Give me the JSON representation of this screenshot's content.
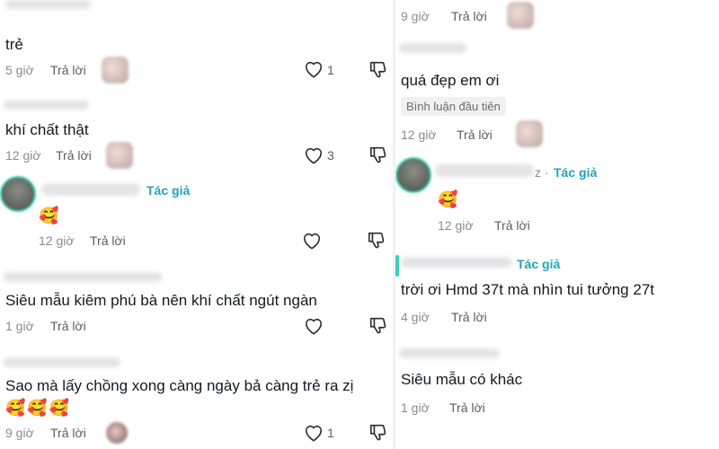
{
  "left": {
    "c1": {
      "text": "trẻ",
      "time": "5 giờ",
      "reply": "Trả lời",
      "likes": "1"
    },
    "c2": {
      "text": "khí chất thật",
      "time": "12 giờ",
      "reply": "Trả lời",
      "likes": "3"
    },
    "c3": {
      "author_tag": "Tác giả",
      "emoji": "🥰",
      "time": "12 giờ",
      "reply": "Trả lời"
    },
    "c4": {
      "text": "Siêu mẫu kiêm phú bà nên khí chất ngút ngàn",
      "time": "1 giờ",
      "reply": "Trả lời"
    },
    "c5": {
      "text": "Sao mà lấy chồng xong càng ngày bả càng trẻ ra zị",
      "emojis": "🥰🥰🥰",
      "time": "9 giờ",
      "reply": "Trả lời",
      "likes": "1"
    }
  },
  "right": {
    "c0": {
      "time": "9 giờ",
      "reply": "Trả lời"
    },
    "c1": {
      "text": "quá đẹp em ơi",
      "badge": "Bình luận đầu tiên",
      "time": "12 giờ",
      "reply": "Trả lời"
    },
    "c2": {
      "name_suffix": "z ·",
      "author_tag": "Tác giả",
      "emoji": "🥰",
      "time": "12 giờ",
      "reply": "Trả lời"
    },
    "c3": {
      "author_tag": "Tác giả",
      "text": "trời ơi Hmd 37t mà nhìn tui tưởng 27t",
      "time": "4 giờ",
      "reply": "Trả lời"
    },
    "c4": {
      "text": "Siêu mẫu có khác",
      "time": "1 giờ",
      "reply": "Trả lời"
    }
  },
  "colors": {
    "author": "#20a4b8",
    "meta": "#8a8b91",
    "text": "#161823"
  },
  "icons": [
    "heart-outline-icon",
    "dislike-icon",
    "grinning-hearts-emoji"
  ]
}
